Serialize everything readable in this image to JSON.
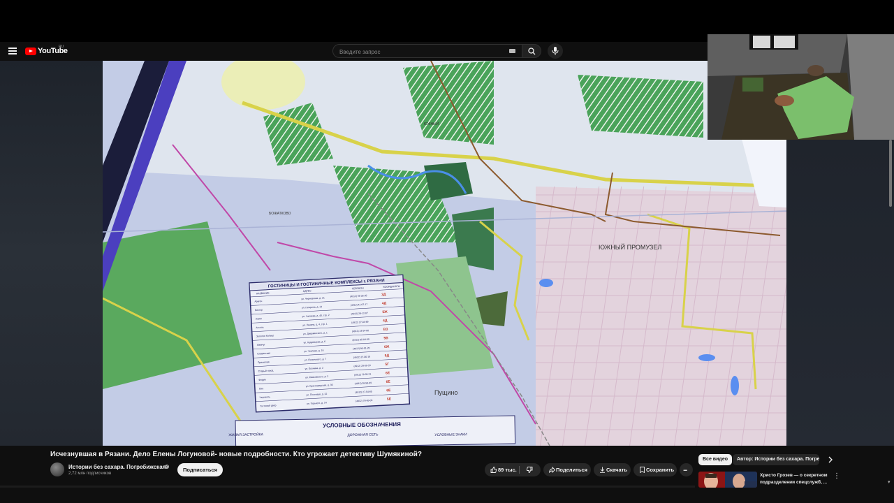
{
  "masthead": {
    "logo_text": "YouTube",
    "logo_region": "RU",
    "search_placeholder": "Введите запрос"
  },
  "map": {
    "labels": {
      "south_industrial": "ЮЖНЫЙ ПРОМУЗЕЛ",
      "pushchino": "Пущино",
      "bozhatkovo": "БОЖАТКОВО",
      "yuzhny": "ЮЖНЫЙ",
      "legend_title": "УСЛОВНЫЕ ОБОЗНАЧЕНИЯ",
      "legend_a": "ЖИЛАЯ ЗАСТРОЙКА",
      "legend_b": "ДОРОЖНАЯ СЕТЬ",
      "legend_c": "УСЛОВНЫЕ ЗНАКИ"
    },
    "hotel_table": {
      "title": "ГОСТИНИЦЫ И ГОСТИНИЧНЫЕ КОМПЛЕКСЫ г. РЯЗАНИ",
      "headers": [
        "НАЗВАНИЕ",
        "АДРЕС",
        "ТЕЛЕФОН",
        "КООРДИНАТЫ"
      ],
      "rows": [
        [
          "Арагон",
          "ул. Черновская, д. 21",
          "(4912) 95-35-35",
          "3Д"
        ],
        [
          "Вектор",
          "ул. Гагарина, д. 14",
          "(4912) 41-67-17",
          "4Д"
        ],
        [
          "Ловеч",
          "ул. Чапаева, д. 40, стр. 2",
          "(4912) 28-12-07",
          "5Ж"
        ],
        [
          "Ассоль",
          "ул. Ленина, д. 4, стр. 1",
          "(4912) 27-04-89",
          "4Д"
        ],
        [
          "Золотое Кольцо",
          "ул. Дзержинского, д. 1",
          "(4912) 24-54-00",
          "ВЗ"
        ],
        [
          "Жемчуг",
          "ул. Кудрявцева, д. 6",
          "(4912) 95-04-09",
          "5В"
        ],
        [
          "Славянская",
          "ул. Чкалова, д. 16",
          "(4912) 96-91-20",
          "6Ж"
        ],
        [
          "Приокская",
          "ул. Полонского, д. 7",
          "(4912) 27-00-16",
          "5Д"
        ],
        [
          "Старый город",
          "ул. Есенина, д. 2",
          "(4912) 29-00-10",
          "5Г"
        ],
        [
          "Форум",
          "ул. Маяковского, д. 2",
          "(4912) 79-35-21",
          "6Е"
        ],
        [
          "Ока",
          "ул. Краснорядская, д. 35",
          "(4912) 28-58-99",
          "6Е"
        ],
        [
          "Черчилль",
          "ул. Почтовая, д. 22",
          "(4912) 27-54-85",
          "6Е"
        ],
        [
          "Гостиный двор",
          "ул. Горького, д. 14",
          "(4912) 78-65-03",
          "5Е"
        ]
      ]
    }
  },
  "video": {
    "title": "Исчезнувшая в Рязани. Дело Елены Логуновой- новые подробности. Кто угрожает детективу Шумякиной?"
  },
  "channel": {
    "name": "Истории без сахара. Погребижская.",
    "subscribers": "2,72 млн подписчиков",
    "subscribe_label": "Подписаться"
  },
  "actions": {
    "likes": "89 тыс.",
    "share": "Поделиться",
    "download": "Скачать",
    "save": "Сохранить",
    "more": "..."
  },
  "sidebar": {
    "chips": [
      "Все видео",
      "Автор: Истории без сахара. Погребижская."
    ],
    "recommendation": {
      "title_line1": "Христо Грозев — о секретном",
      "title_line2": "подразделении спецслужб, ..."
    }
  },
  "colors": {
    "background": "#0f0f0f",
    "accent": "#ff0000",
    "text": "#f1f1f1"
  }
}
